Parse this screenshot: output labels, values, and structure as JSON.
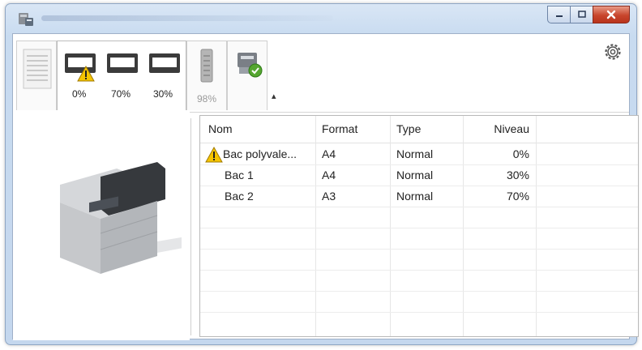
{
  "toolbar": {
    "toner_levels": [
      {
        "label": "0%",
        "level": 0,
        "warning": true
      },
      {
        "label": "70%",
        "level": 70,
        "warning": false
      },
      {
        "label": "30%",
        "level": 30,
        "warning": false
      }
    ],
    "memory": {
      "label": "98%",
      "level": 98
    },
    "collapse_glyph": "▴",
    "settings_icon": "gear-icon"
  },
  "table": {
    "columns": [
      "Nom",
      "Format",
      "Type",
      "Niveau"
    ],
    "rows": [
      {
        "nom": "Bac polyvale...",
        "format": "A4",
        "type": "Normal",
        "niveau": "0%",
        "warning": true
      },
      {
        "nom": "Bac 1",
        "format": "A4",
        "type": "Normal",
        "niveau": "30%",
        "warning": false
      },
      {
        "nom": "Bac 2",
        "format": "A3",
        "type": "Normal",
        "niveau": "70%",
        "warning": false
      }
    ]
  },
  "colors": {
    "warning": "#f5c400",
    "close_button": "#c8452c",
    "accent": "#2b6cb0"
  }
}
